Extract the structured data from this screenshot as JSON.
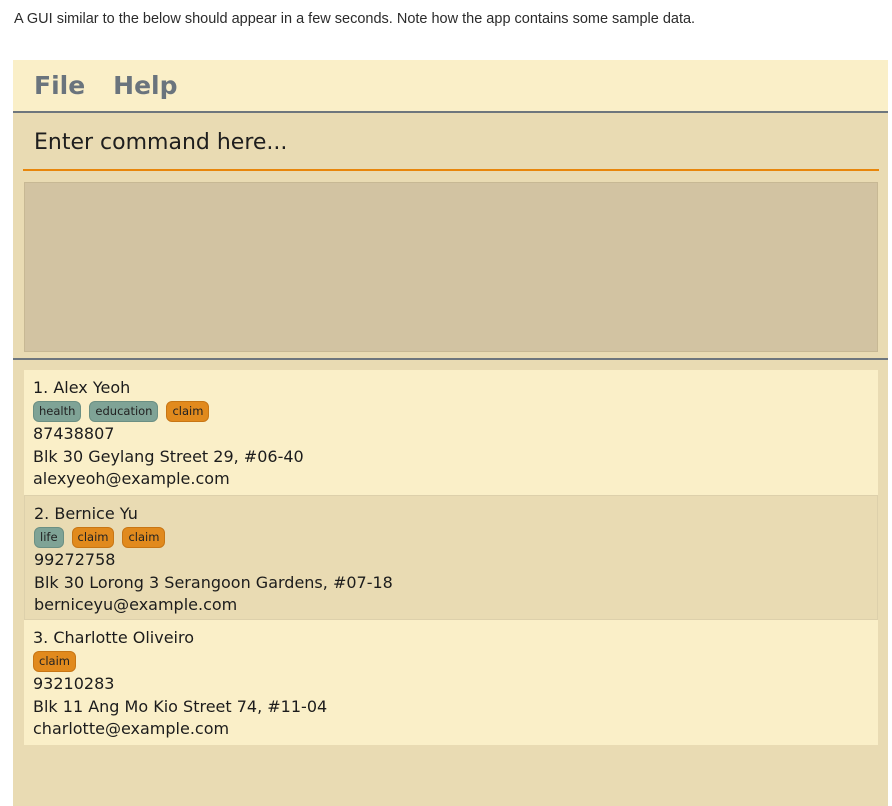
{
  "intro_text": "A GUI similar to the below should appear in a few seconds. Note how the app contains some sample data.",
  "menu": [
    {
      "label": "File"
    },
    {
      "label": "Help"
    }
  ],
  "command": {
    "placeholder": "Enter command here..."
  },
  "persons": [
    {
      "name": "1. Alex Yeoh",
      "tags": [
        {
          "label": "health",
          "color": "teal"
        },
        {
          "label": "education",
          "color": "teal"
        },
        {
          "label": "claim",
          "color": "orange"
        }
      ],
      "phone": "87438807",
      "address": "Blk 30 Geylang Street 29, #06-40",
      "email": "alexyeoh@example.com"
    },
    {
      "name": "2. Bernice Yu",
      "tags": [
        {
          "label": "life",
          "color": "teal"
        },
        {
          "label": "claim",
          "color": "orange"
        },
        {
          "label": "claim",
          "color": "orange"
        }
      ],
      "phone": "99272758",
      "address": "Blk 30 Lorong 3 Serangoon Gardens, #07-18",
      "email": "berniceyu@example.com"
    },
    {
      "name": "3. Charlotte Oliveiro",
      "tags": [
        {
          "label": "claim",
          "color": "orange"
        }
      ],
      "phone": "93210283",
      "address": "Blk 11 Ang Mo Kio Street 74, #11-04",
      "email": "charlotte@example.com"
    }
  ],
  "colors": {
    "menubar_bg": "#faefc8",
    "app_bg": "#e9dbb3",
    "result_bg": "#d2c3a2",
    "tag_teal": "#7fa396",
    "tag_orange": "#e18a1d",
    "accent_underline": "#e8860b"
  }
}
